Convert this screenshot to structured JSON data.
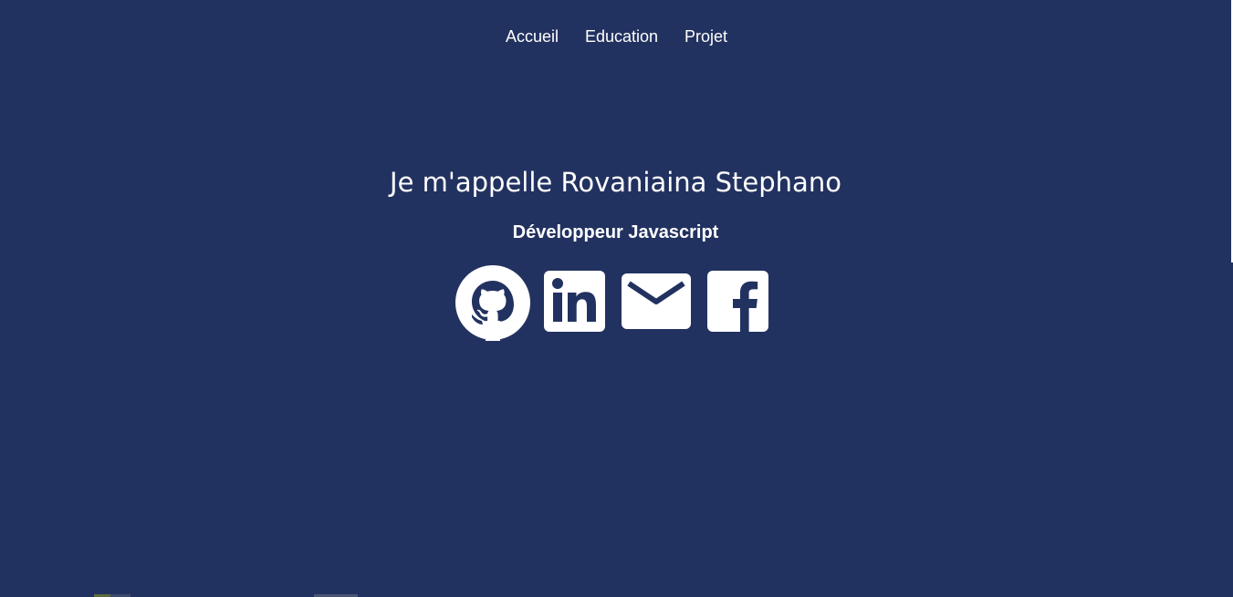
{
  "nav": {
    "items": [
      {
        "label": "Accueil"
      },
      {
        "label": "Education"
      },
      {
        "label": "Projet"
      }
    ]
  },
  "hero": {
    "title": "Je m'appelle Rovaniaina Stephano",
    "subtitle": "Développeur Javascript"
  },
  "social": [
    {
      "icon": "github-icon"
    },
    {
      "icon": "linkedin-icon"
    },
    {
      "icon": "mail-icon"
    },
    {
      "icon": "facebook-icon"
    }
  ],
  "colors": {
    "background": "#223260",
    "foreground": "#ffffff"
  }
}
